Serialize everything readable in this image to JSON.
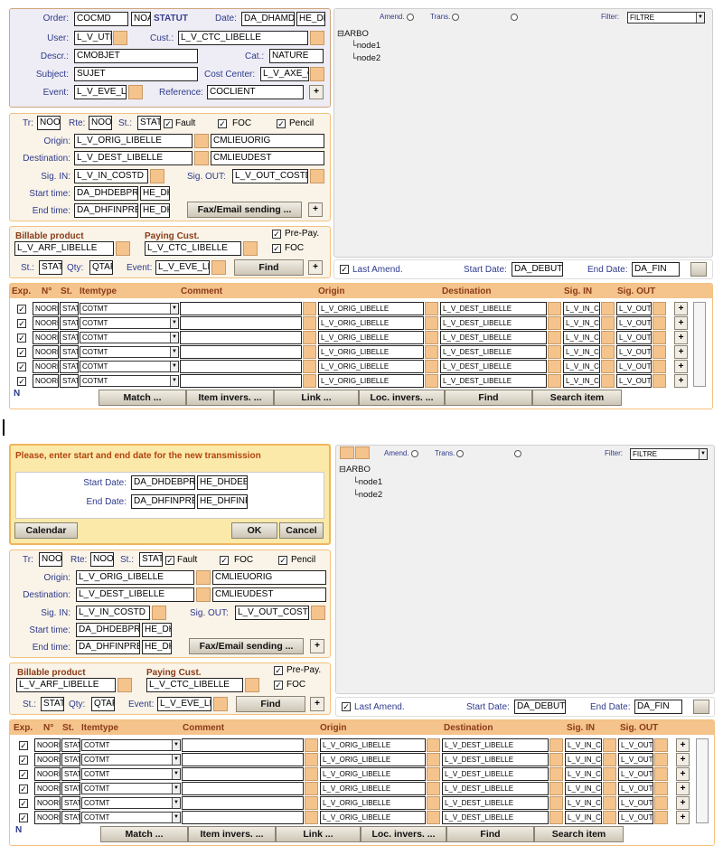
{
  "order": {
    "order_label": "Order:",
    "order_value": "COCMD",
    "noa": "NOA",
    "statut": "STATUT",
    "date_label": "Date:",
    "date_value": "DA_DHAMD",
    "he_value": "HE_DH",
    "user_label": "User:",
    "user_value": "L_V_UTI",
    "cust_label": "Cust.:",
    "cust_value": "L_V_CTC_LIBELLE",
    "descr_label": "Descr.:",
    "descr_value": "CMOBJET",
    "cat_label": "Cat.:",
    "cat_value": "NATURE",
    "subject_label": "Subject:",
    "subject_value": "SUJET",
    "cost_label": "Cost Center:",
    "cost_value": "L_V_AXE_C",
    "event_label": "Event:",
    "event_value": "L_V_EVE_LI",
    "ref_label": "Reference:",
    "ref_value": "COCLIENT",
    "plus": "+"
  },
  "dialog": {
    "title": "Please, enter start and end date for the new transmission",
    "start_label": "Start Date:",
    "start_date": "DA_DHDEBPRE",
    "start_he": "HE_DHDEB",
    "end_label": "End Date:",
    "end_date": "DA_DHFINPRE",
    "end_he": "HE_DHFINF",
    "calendar": "Calendar",
    "ok": "OK",
    "cancel": "Cancel"
  },
  "transmission": {
    "tr_label": "Tr:",
    "tr_value": "NOO",
    "rte_label": "Rte:",
    "rte_value": "NOO",
    "st_label": "St.:",
    "st_value": "STAT",
    "fault": "Fault",
    "foc": "FOC",
    "pencil": "Pencil",
    "origin_label": "Origin:",
    "origin_value": "L_V_ORIG_LIBELLE",
    "origin_code": "CMLIEUORIG",
    "dest_label": "Destination:",
    "dest_value": "L_V_DEST_LIBELLE",
    "dest_code": "CMLIEUDEST",
    "sigin_label": "Sig. IN:",
    "sigin_value": "L_V_IN_COSTD",
    "sigout_label": "Sig. OUT:",
    "sigout_value": "L_V_OUT_COSTD",
    "start_label": "Start time:",
    "start_value": "DA_DHDEBPR",
    "start_he": "HE_DH",
    "end_label": "End time:",
    "end_value": "DA_DHFINPRE",
    "end_he": "HE_DH",
    "fax_button": "Fax/Email sending ...",
    "plus": "+"
  },
  "billing": {
    "product_label": "Billable product",
    "product_value": "L_V_ARF_LIBELLE",
    "paying_label": "Paying Cust.",
    "paying_value": "L_V_CTC_LIBELLE",
    "prepay": "Pre-Pay.",
    "foc": "FOC",
    "st_label": "St.:",
    "st_value": "STAT",
    "qty_label": "Qty:",
    "qty_value": "QTAF",
    "event_label": "Event:",
    "event_value": "L_V_EVE_LI",
    "find": "Find",
    "plus": "+"
  },
  "tree_panel": {
    "amend": "Amend.",
    "trans": "Trans.",
    "filter_label": "Filter:",
    "filter_value": "FILTRE",
    "root": "ARBO",
    "node1": "node1",
    "node2": "node2"
  },
  "dates_bar": {
    "last_amend": "Last Amend.",
    "start_label": "Start Date:",
    "start_value": "DA_DEBUT",
    "end_label": "End Date:",
    "end_value": "DA_FIN"
  },
  "grid": {
    "headers": {
      "exp": "Exp.",
      "no": "N°",
      "st": "St.",
      "type": "Itemtype",
      "comment": "Comment",
      "origin": "Origin",
      "destination": "Destination",
      "sigin": "Sig. IN",
      "sigout": "Sig. OUT"
    },
    "rows": [
      {
        "no": "NOORD",
        "st": "STAT",
        "type": "COTMT",
        "origin": "L_V_ORIG_LIBELLE",
        "dest": "L_V_DEST_LIBELLE",
        "sigin": "L_V_IN_CO",
        "sigout": "L_V_OUT_"
      },
      {
        "no": "NOORD",
        "st": "STAT",
        "type": "COTMT",
        "origin": "L_V_ORIG_LIBELLE",
        "dest": "L_V_DEST_LIBELLE",
        "sigin": "L_V_IN_CO",
        "sigout": "L_V_OUT_"
      },
      {
        "no": "NOORD",
        "st": "STAT",
        "type": "COTMT",
        "origin": "L_V_ORIG_LIBELLE",
        "dest": "L_V_DEST_LIBELLE",
        "sigin": "L_V_IN_CO",
        "sigout": "L_V_OUT_"
      },
      {
        "no": "NOORD",
        "st": "STAT",
        "type": "COTMT",
        "origin": "L_V_ORIG_LIBELLE",
        "dest": "L_V_DEST_LIBELLE",
        "sigin": "L_V_IN_CO",
        "sigout": "L_V_OUT_"
      },
      {
        "no": "NOORD",
        "st": "STAT",
        "type": "COTMT",
        "origin": "L_V_ORIG_LIBELLE",
        "dest": "L_V_DEST_LIBELLE",
        "sigin": "L_V_IN_CO",
        "sigout": "L_V_OUT_"
      },
      {
        "no": "NOORD",
        "st": "STAT",
        "type": "COTMT",
        "origin": "L_V_ORIG_LIBELLE",
        "dest": "L_V_DEST_LIBELLE",
        "sigin": "L_V_IN_CO",
        "sigout": "L_V_OUT_"
      }
    ],
    "plus": "+"
  },
  "actions": {
    "match": "Match ...",
    "item_invers": "Item invers. ...",
    "link": "Link ...",
    "loc_invers": "Loc. invers. ...",
    "find": "Find",
    "search_item": "Search item",
    "n": "N"
  },
  "colors": {
    "panel_border": "#f2c27e",
    "grid_header": "#f5c38c",
    "label": "#2e3a8c",
    "header_text": "#8a3c18",
    "dialog_bg": "#fbe9a9",
    "dialog_title": "#b14410"
  }
}
